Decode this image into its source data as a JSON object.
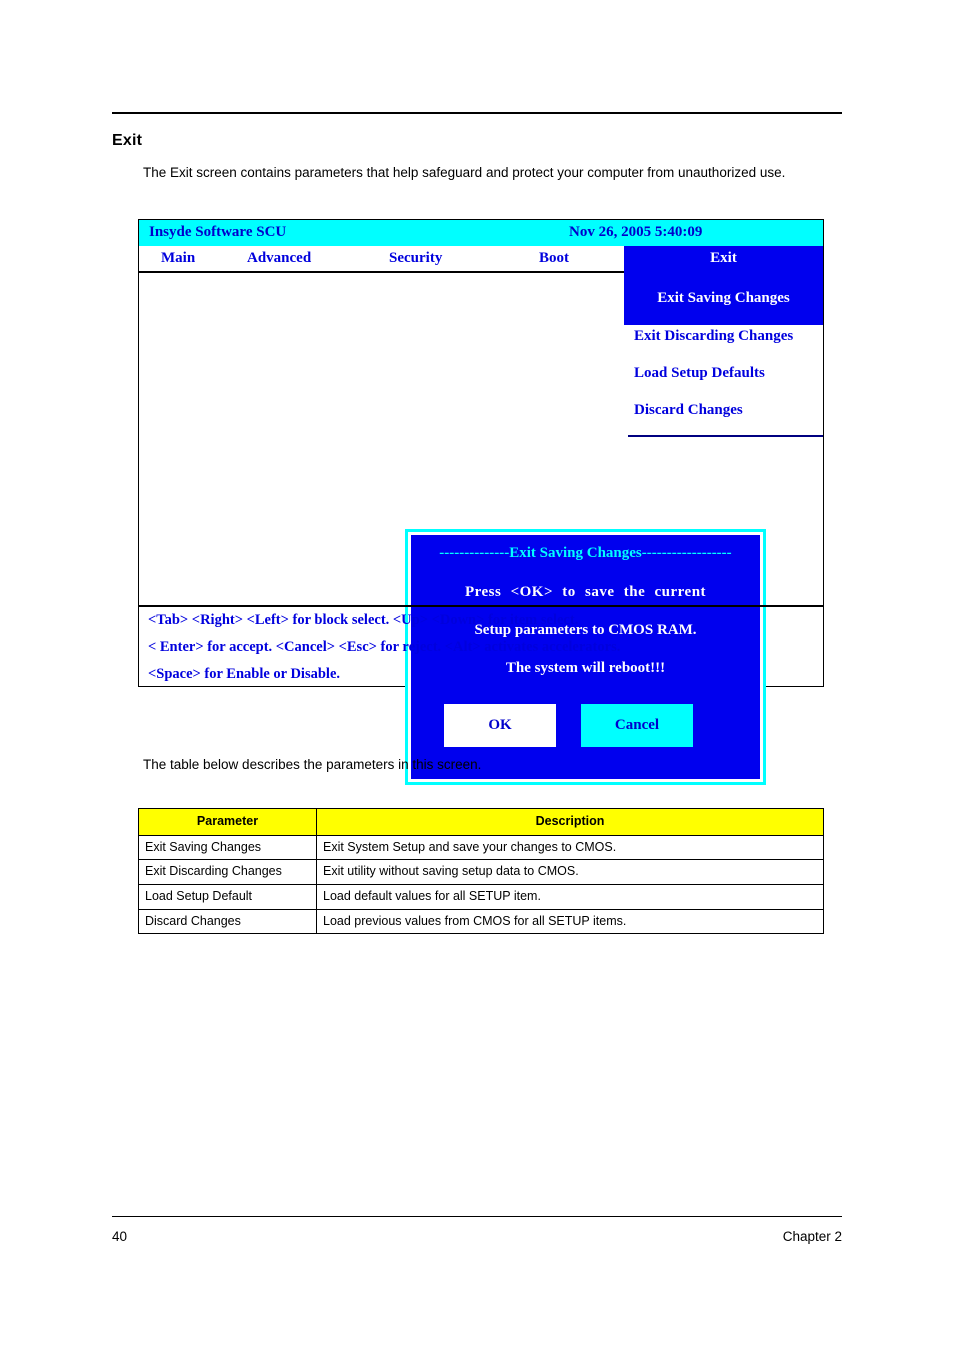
{
  "page": {
    "section_title": "Exit",
    "intro": "The Exit screen contains parameters that help safeguard and protect your computer from unauthorized use.",
    "table_intro": "The table below describes the parameters in this screen.",
    "footer_page_number": "40",
    "footer_chapter": "Chapter 2"
  },
  "bios": {
    "title_left": "Insyde Software SCU",
    "title_right": "Nov 26, 2005 5:40:09",
    "tabs": [
      {
        "label": "Main",
        "selected": false
      },
      {
        "label": "Advanced",
        "selected": false
      },
      {
        "label": "Security",
        "selected": false
      },
      {
        "label": "Boot",
        "selected": false
      },
      {
        "label": "Exit",
        "selected": true
      }
    ],
    "highlighted_menu_item": "Exit Saving Changes",
    "menu_items": [
      "Exit Discarding Changes",
      "Load Setup Defaults",
      "Discard Changes"
    ],
    "help_lines": [
      "<Tab> <Right> <Left> for block select.    <Up> <Down> for item select.",
      "< Enter> for accept. <Cancel> <Esc> for reject. <Alt> activates accelerators.",
      "<Space> for Enable or Disable."
    ],
    "colors": {
      "titlebar": "#00ffff",
      "panel_selected": "#0000ee",
      "text_blue": "#0000dd",
      "text_white": "#ffffff",
      "dialog_heading": "#00ffff"
    }
  },
  "dialog": {
    "heading": "--------------Exit Saving Changes------------------",
    "message_lines": [
      "Press   <OK>   to   save   the current",
      "Setup parameters to CMOS RAM.",
      "The system will reboot!!!"
    ],
    "buttons": [
      {
        "label": "OK"
      },
      {
        "label": "Cancel"
      }
    ]
  },
  "param_table": {
    "headers": [
      "Parameter",
      "Description"
    ],
    "rows": [
      [
        "Exit Saving Changes",
        "Exit System Setup and save your changes to CMOS."
      ],
      [
        "Exit Discarding Changes",
        "Exit utility without saving setup data to CMOS."
      ],
      [
        "Load Setup Default",
        "Load default values for all SETUP item."
      ],
      [
        "Discard Changes",
        "Load previous values from CMOS for all SETUP items."
      ]
    ]
  }
}
